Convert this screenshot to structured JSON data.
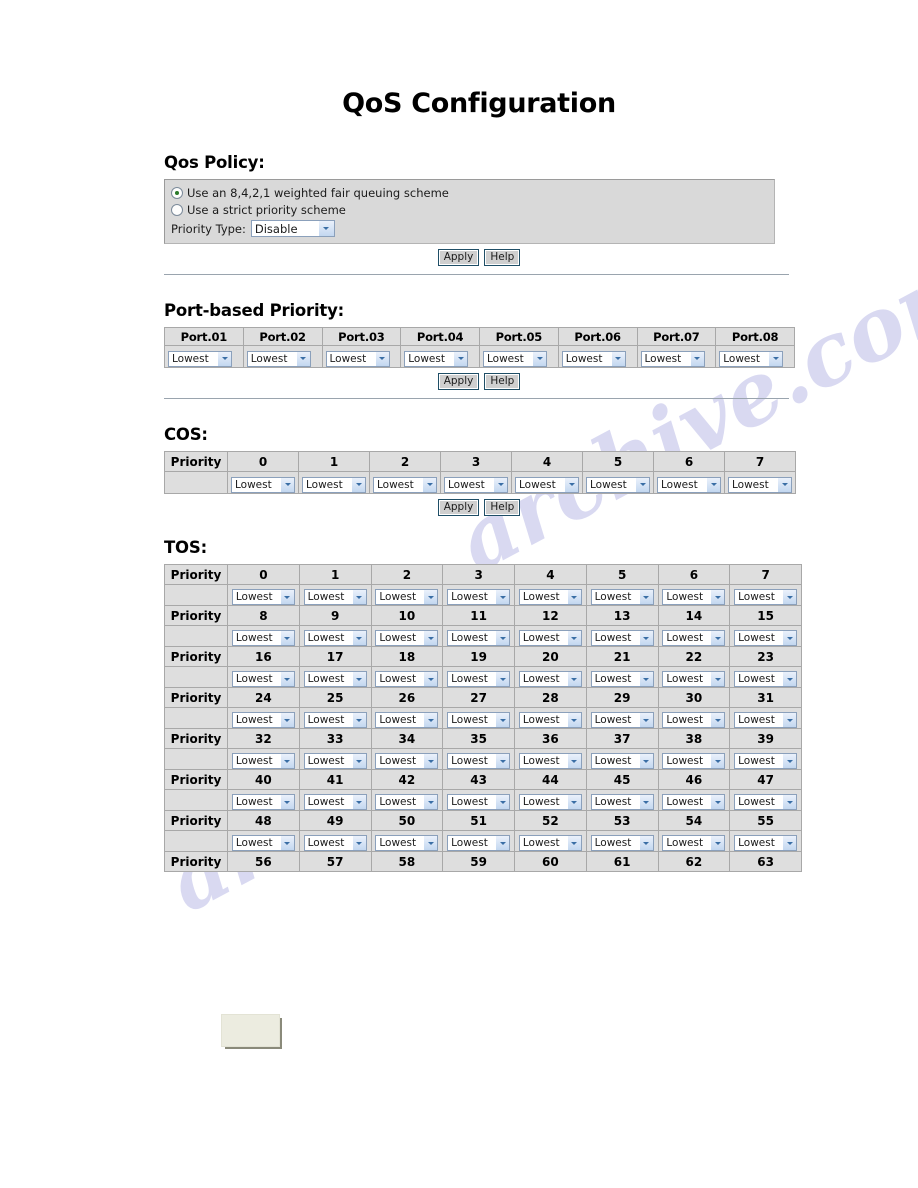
{
  "page": {
    "title": "QoS Configuration"
  },
  "qos_policy": {
    "heading": "Qos Policy:",
    "options": [
      {
        "label": "Use an 8,4,2,1 weighted fair queuing scheme",
        "selected": true
      },
      {
        "label": "Use a strict priority scheme",
        "selected": false
      }
    ],
    "priority_type_label": "Priority Type:",
    "priority_type_value": "Disable",
    "apply_label": "Apply",
    "help_label": "Help"
  },
  "port_based": {
    "heading": "Port-based Priority:",
    "columns": [
      "Port.01",
      "Port.02",
      "Port.03",
      "Port.04",
      "Port.05",
      "Port.06",
      "Port.07",
      "Port.08"
    ],
    "values": [
      "Lowest",
      "Lowest",
      "Lowest",
      "Lowest",
      "Lowest",
      "Lowest",
      "Lowest",
      "Lowest"
    ],
    "apply_label": "Apply",
    "help_label": "Help"
  },
  "cos": {
    "heading": "COS:",
    "row_label": "Priority",
    "columns": [
      "0",
      "1",
      "2",
      "3",
      "4",
      "5",
      "6",
      "7"
    ],
    "values": [
      "Lowest",
      "Lowest",
      "Lowest",
      "Lowest",
      "Lowest",
      "Lowest",
      "Lowest",
      "Lowest"
    ],
    "apply_label": "Apply",
    "help_label": "Help"
  },
  "tos": {
    "heading": "TOS:",
    "row_label": "Priority",
    "select_value": "Lowest",
    "rows": [
      {
        "label": "Priority",
        "numbers": [
          "0",
          "1",
          "2",
          "3",
          "4",
          "5",
          "6",
          "7"
        ],
        "values": [
          "Lowest",
          "Lowest",
          "Lowest",
          "Lowest",
          "Lowest",
          "Lowest",
          "Lowest",
          "Lowest"
        ]
      },
      {
        "label": "Priority",
        "numbers": [
          "8",
          "9",
          "10",
          "11",
          "12",
          "13",
          "14",
          "15"
        ],
        "values": [
          "Lowest",
          "Lowest",
          "Lowest",
          "Lowest",
          "Lowest",
          "Lowest",
          "Lowest",
          "Lowest"
        ]
      },
      {
        "label": "Priority",
        "numbers": [
          "16",
          "17",
          "18",
          "19",
          "20",
          "21",
          "22",
          "23"
        ],
        "values": [
          "Lowest",
          "Lowest",
          "Lowest",
          "Lowest",
          "Lowest",
          "Lowest",
          "Lowest",
          "Lowest"
        ]
      },
      {
        "label": "Priority",
        "numbers": [
          "24",
          "25",
          "26",
          "27",
          "28",
          "29",
          "30",
          "31"
        ],
        "values": [
          "Lowest",
          "Lowest",
          "Lowest",
          "Lowest",
          "Lowest",
          "Lowest",
          "Lowest",
          "Lowest"
        ]
      },
      {
        "label": "Priority",
        "numbers": [
          "32",
          "33",
          "34",
          "35",
          "36",
          "37",
          "38",
          "39"
        ],
        "values": [
          "Lowest",
          "Lowest",
          "Lowest",
          "Lowest",
          "Lowest",
          "Lowest",
          "Lowest",
          "Lowest"
        ]
      },
      {
        "label": "Priority",
        "numbers": [
          "40",
          "41",
          "42",
          "43",
          "44",
          "45",
          "46",
          "47"
        ],
        "values": [
          "Lowest",
          "Lowest",
          "Lowest",
          "Lowest",
          "Lowest",
          "Lowest",
          "Lowest",
          "Lowest"
        ]
      },
      {
        "label": "Priority",
        "numbers": [
          "48",
          "49",
          "50",
          "51",
          "52",
          "53",
          "54",
          "55"
        ],
        "values": [
          "Lowest",
          "Lowest",
          "Lowest",
          "Lowest",
          "Lowest",
          "Lowest",
          "Lowest",
          "Lowest"
        ]
      },
      {
        "label": "Priority",
        "numbers": [
          "56",
          "57",
          "58",
          "59",
          "60",
          "61",
          "62",
          "63"
        ],
        "values": []
      }
    ]
  },
  "watermark": {
    "text": "archive.com"
  },
  "colors": {
    "table_header_bg": "#dedede",
    "policy_box_bg": "#d9d9d9",
    "border": "#a8a8a8",
    "radio_selected": "#2a7a2a",
    "select_border": "#8ba0bb",
    "button_border": "#1f4e66",
    "bottom_box": "#ecece0"
  }
}
